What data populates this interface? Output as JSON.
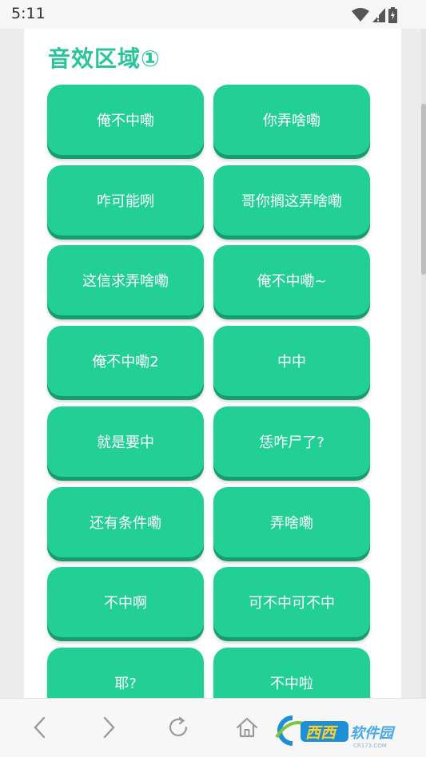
{
  "status_bar": {
    "time": "5:11"
  },
  "section": {
    "title": "音效区域①"
  },
  "buttons": [
    "俺不中嘞",
    "你弄啥嘞",
    "咋可能咧",
    "哥你搁这弄啥嘞",
    "这信求弄啥嘞",
    "俺不中嘞~",
    "俺不中嘞2",
    "中中",
    "就是要中",
    "恁咋尸了?",
    "还有条件嘞",
    "弄啥嘞",
    "不中啊",
    "可不中可不中",
    "耶?",
    "不中啦"
  ],
  "colors": {
    "accent": "#2bc59a",
    "button": "#22cf94",
    "button_shadow": "#179d6d"
  },
  "bottom_nav": {
    "icons": [
      "back-icon",
      "forward-icon",
      "refresh-icon",
      "home-icon"
    ]
  },
  "watermark": {
    "brand": "西西软件园",
    "url": "CR173.COM"
  }
}
